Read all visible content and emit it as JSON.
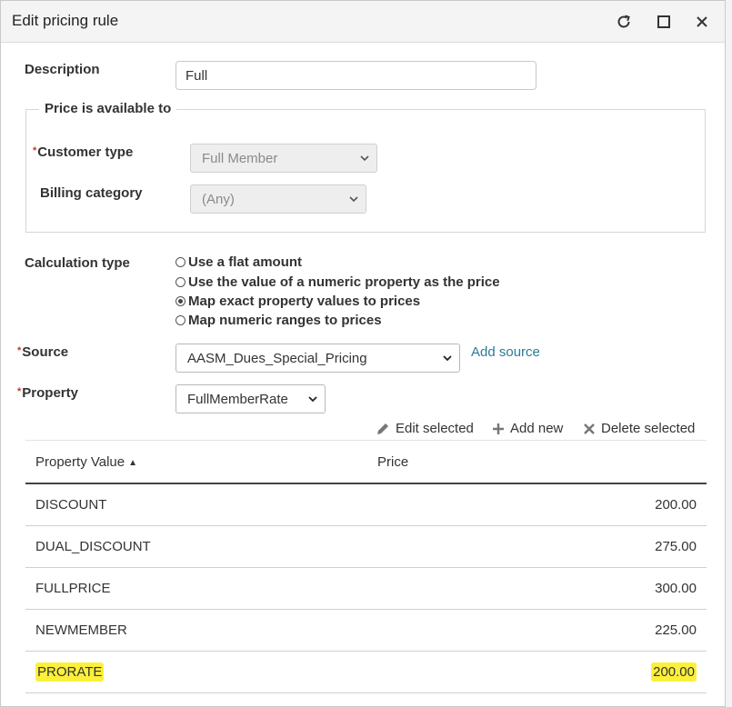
{
  "window": {
    "title": "Edit pricing rule",
    "controls": {
      "refresh": "refresh-icon",
      "maximize": "maximize-icon",
      "close": "close-icon"
    }
  },
  "description": {
    "label": "Description",
    "value": "Full"
  },
  "availability": {
    "legend": "Price is available to",
    "customer_type": {
      "label": "Customer type",
      "value": "Full Member"
    },
    "billing_category": {
      "label": "Billing category",
      "value": "(Any)"
    }
  },
  "calculation": {
    "label": "Calculation type",
    "options": [
      {
        "label": "Use a flat amount",
        "checked": false
      },
      {
        "label": "Use the value of a numeric property as the price",
        "checked": false
      },
      {
        "label": "Map exact property values to prices",
        "checked": true
      },
      {
        "label": "Map numeric ranges to prices",
        "checked": false
      }
    ]
  },
  "source": {
    "label": "Source",
    "value": "AASM_Dues_Special_Pricing",
    "add_link": "Add source"
  },
  "property": {
    "label": "Property",
    "value": "FullMemberRate"
  },
  "toolbar": {
    "edit": "Edit selected",
    "add": "Add new",
    "delete": "Delete selected"
  },
  "table": {
    "columns": [
      "Property Value",
      "Price"
    ],
    "sort_indicator": "▲",
    "rows": [
      {
        "value": "DISCOUNT",
        "price": "200.00"
      },
      {
        "value": "DUAL_DISCOUNT",
        "price": "275.00"
      },
      {
        "value": "FULLPRICE",
        "price": "300.00"
      },
      {
        "value": "NEWMEMBER",
        "price": "225.00"
      },
      {
        "value": "PRORATE",
        "price": "200.00",
        "highlighted": true
      }
    ]
  },
  "colors": {
    "highlight": "#fbf03a",
    "link": "#2a7a9a",
    "required": "#c0392b"
  }
}
